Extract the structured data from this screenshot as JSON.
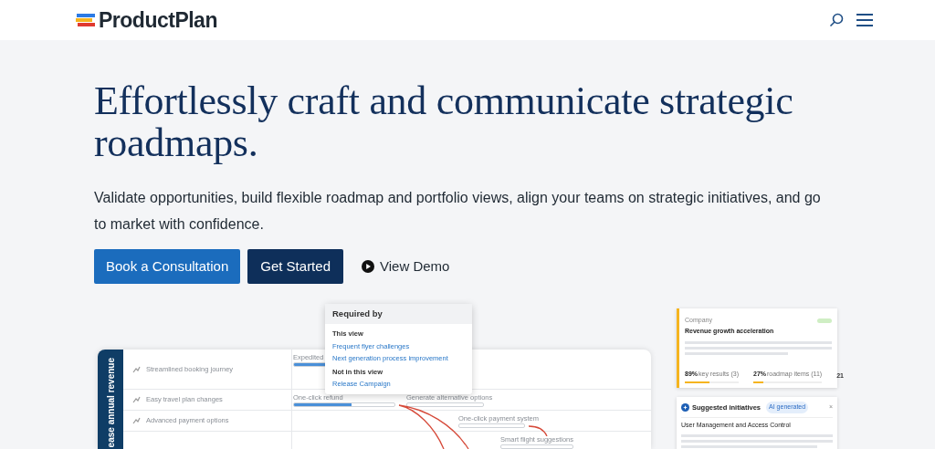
{
  "header": {
    "logo_text": "ProductPlan"
  },
  "hero": {
    "heading": "Effortlessly craft and communicate strategic roadmaps.",
    "subheading": "Validate opportunities, build flexible roadmap and portfolio views, align your teams on strategic initiatives, and go to market with confidence.",
    "buttons": [
      {
        "label": "Book a Consultation",
        "kind": "primary"
      },
      {
        "label": "Get Started",
        "kind": "dark"
      },
      {
        "label": "View Demo",
        "kind": "play"
      }
    ]
  },
  "roadmap": {
    "lane_label": "ease annual revenue",
    "rows": [
      {
        "name": "Streamlined booking journey",
        "bars": [
          {
            "label": "Expedited",
            "level": 1
          }
        ]
      },
      {
        "name": "Easy travel plan changes",
        "bars": [
          {
            "label": "One-click refund",
            "level": 0.57
          },
          {
            "label": "Generate alternative options",
            "level": 0
          }
        ]
      },
      {
        "name": "Advanced payment options",
        "bars": [
          {
            "label": "One-click payment system",
            "level": 0
          }
        ]
      },
      {
        "name": "",
        "bars": [
          {
            "label": "Smart flight suggestions",
            "level": 0
          }
        ]
      }
    ],
    "popup": {
      "title": "Required by",
      "sections": [
        {
          "heading": "This view",
          "links": [
            "Frequent flyer challenges",
            "Next generation process improvement"
          ]
        },
        {
          "heading": "Not in this view",
          "links": [
            "Release Campaign"
          ]
        }
      ]
    }
  },
  "objective_card": {
    "category": "Company",
    "title": "Revenue growth acceleration",
    "metrics": [
      {
        "value": "89%",
        "label": "key results (3)",
        "level": 0.45,
        "color": "#f5b41f"
      },
      {
        "value": "27%",
        "label": "roadmap items (11)",
        "level": 0.15,
        "color": "#f5b41f"
      }
    ],
    "count": "21"
  },
  "suggestions_card": {
    "title": "Suggested initiatives",
    "badge": "AI generated",
    "close": "×",
    "item": "User Management and Access Control"
  }
}
